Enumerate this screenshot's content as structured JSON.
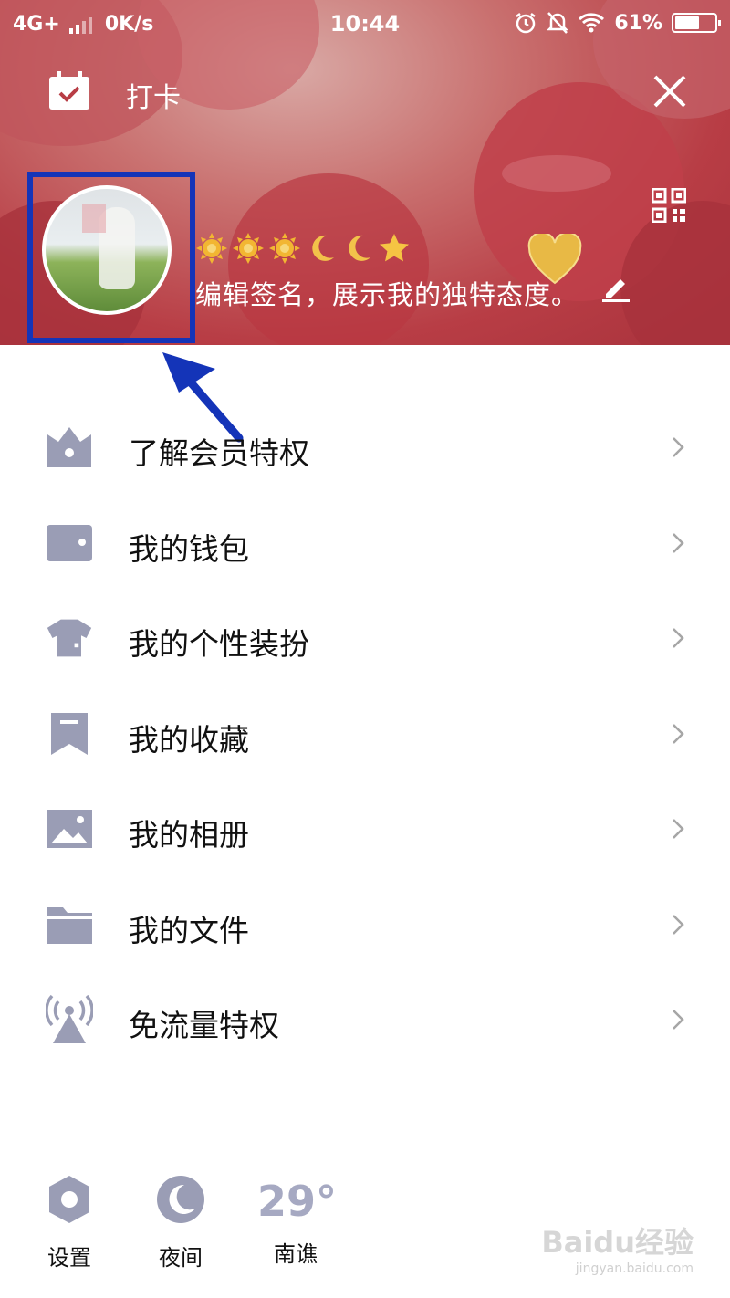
{
  "status_bar": {
    "network": "4G+",
    "speed": "0K/s",
    "time": "10:44",
    "battery": "61%",
    "battery_level": 0.61
  },
  "header": {
    "checkin_label": "打卡",
    "signature": "编辑签名，展示我的独特态度。",
    "level_icons": [
      "sun-icon",
      "sun-icon",
      "sun-icon",
      "moon-icon",
      "moon-icon",
      "star-icon"
    ]
  },
  "menu": {
    "items": [
      {
        "label": "了解会员特权",
        "icon": "crown-icon"
      },
      {
        "label": "我的钱包",
        "icon": "wallet-icon"
      },
      {
        "label": "我的个性装扮",
        "icon": "tshirt-icon"
      },
      {
        "label": "我的收藏",
        "icon": "bookmark-icon"
      },
      {
        "label": "我的相册",
        "icon": "photo-icon"
      },
      {
        "label": "我的文件",
        "icon": "folder-icon"
      },
      {
        "label": "免流量特权",
        "icon": "signal-tower-icon"
      }
    ]
  },
  "bottom": {
    "settings_label": "设置",
    "night_label": "夜间",
    "temperature": "29°",
    "city": "南谯"
  },
  "watermark": {
    "brand": "Baidu经验",
    "url": "jingyan.baidu.com"
  },
  "colors": {
    "icon_gray": "#9a9db5",
    "highlight_blue": "#1434b8",
    "header_red": "#b83d45"
  }
}
